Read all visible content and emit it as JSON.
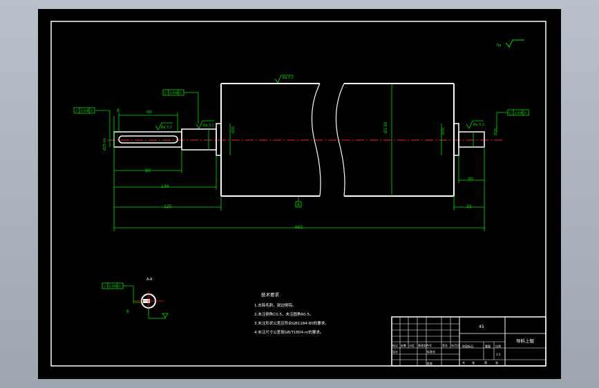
{
  "roughness_general": "Ra",
  "roughness_marks": {
    "body_top": "Ra 3.2",
    "keyway": "Ra 3.2",
    "left_shaft": "Ra 3.2",
    "right_shaft": "Ra 3.2"
  },
  "tolerance_frames": {
    "left_shaft": [
      "//",
      "0.008",
      "A"
    ],
    "left_shoulder": [
      "//",
      "0.008",
      "A"
    ],
    "right_shaft": [
      "//",
      "0.008",
      "A"
    ],
    "section": [
      "//",
      "0.008",
      "A"
    ]
  },
  "datum_label": "A",
  "dimensions": {
    "keyway_top": "60",
    "keyway_bottom": "80",
    "d130": "130",
    "d125": "125",
    "overall": "665",
    "right_30": "30",
    "right_35": "35",
    "keyway_offset": "8",
    "body_diameter": "Ø130",
    "left_journal": "Ø35",
    "left_end": "Ø25 k6",
    "right_journal": "Ø35",
    "right_end": "Ø25"
  },
  "section_label": "A-A",
  "section_dim": "8",
  "technical_requirements": {
    "title": "技术要求",
    "items": [
      "1.去除毛刺，锐边倒钝。",
      "2.未注倒角C0.5，未注圆角R0.5。",
      "3.未注形状公差应符合GB1184-80的要求。",
      "4.未注尺寸公差按GB/T1804-m的要求。"
    ]
  },
  "title_block": {
    "material": "45",
    "name": "导料上辊",
    "scale_label": "比例",
    "scale_value": "1:5",
    "sheet_labels": [
      "共",
      "张",
      "第",
      "张"
    ],
    "labels": [
      "标记",
      "处数",
      "分区",
      "更改文件号",
      "签名",
      "年月日"
    ],
    "design": "设计",
    "standard": "标准化",
    "approve": "批准",
    "stage": "阶段标记",
    "weight": "重量"
  }
}
